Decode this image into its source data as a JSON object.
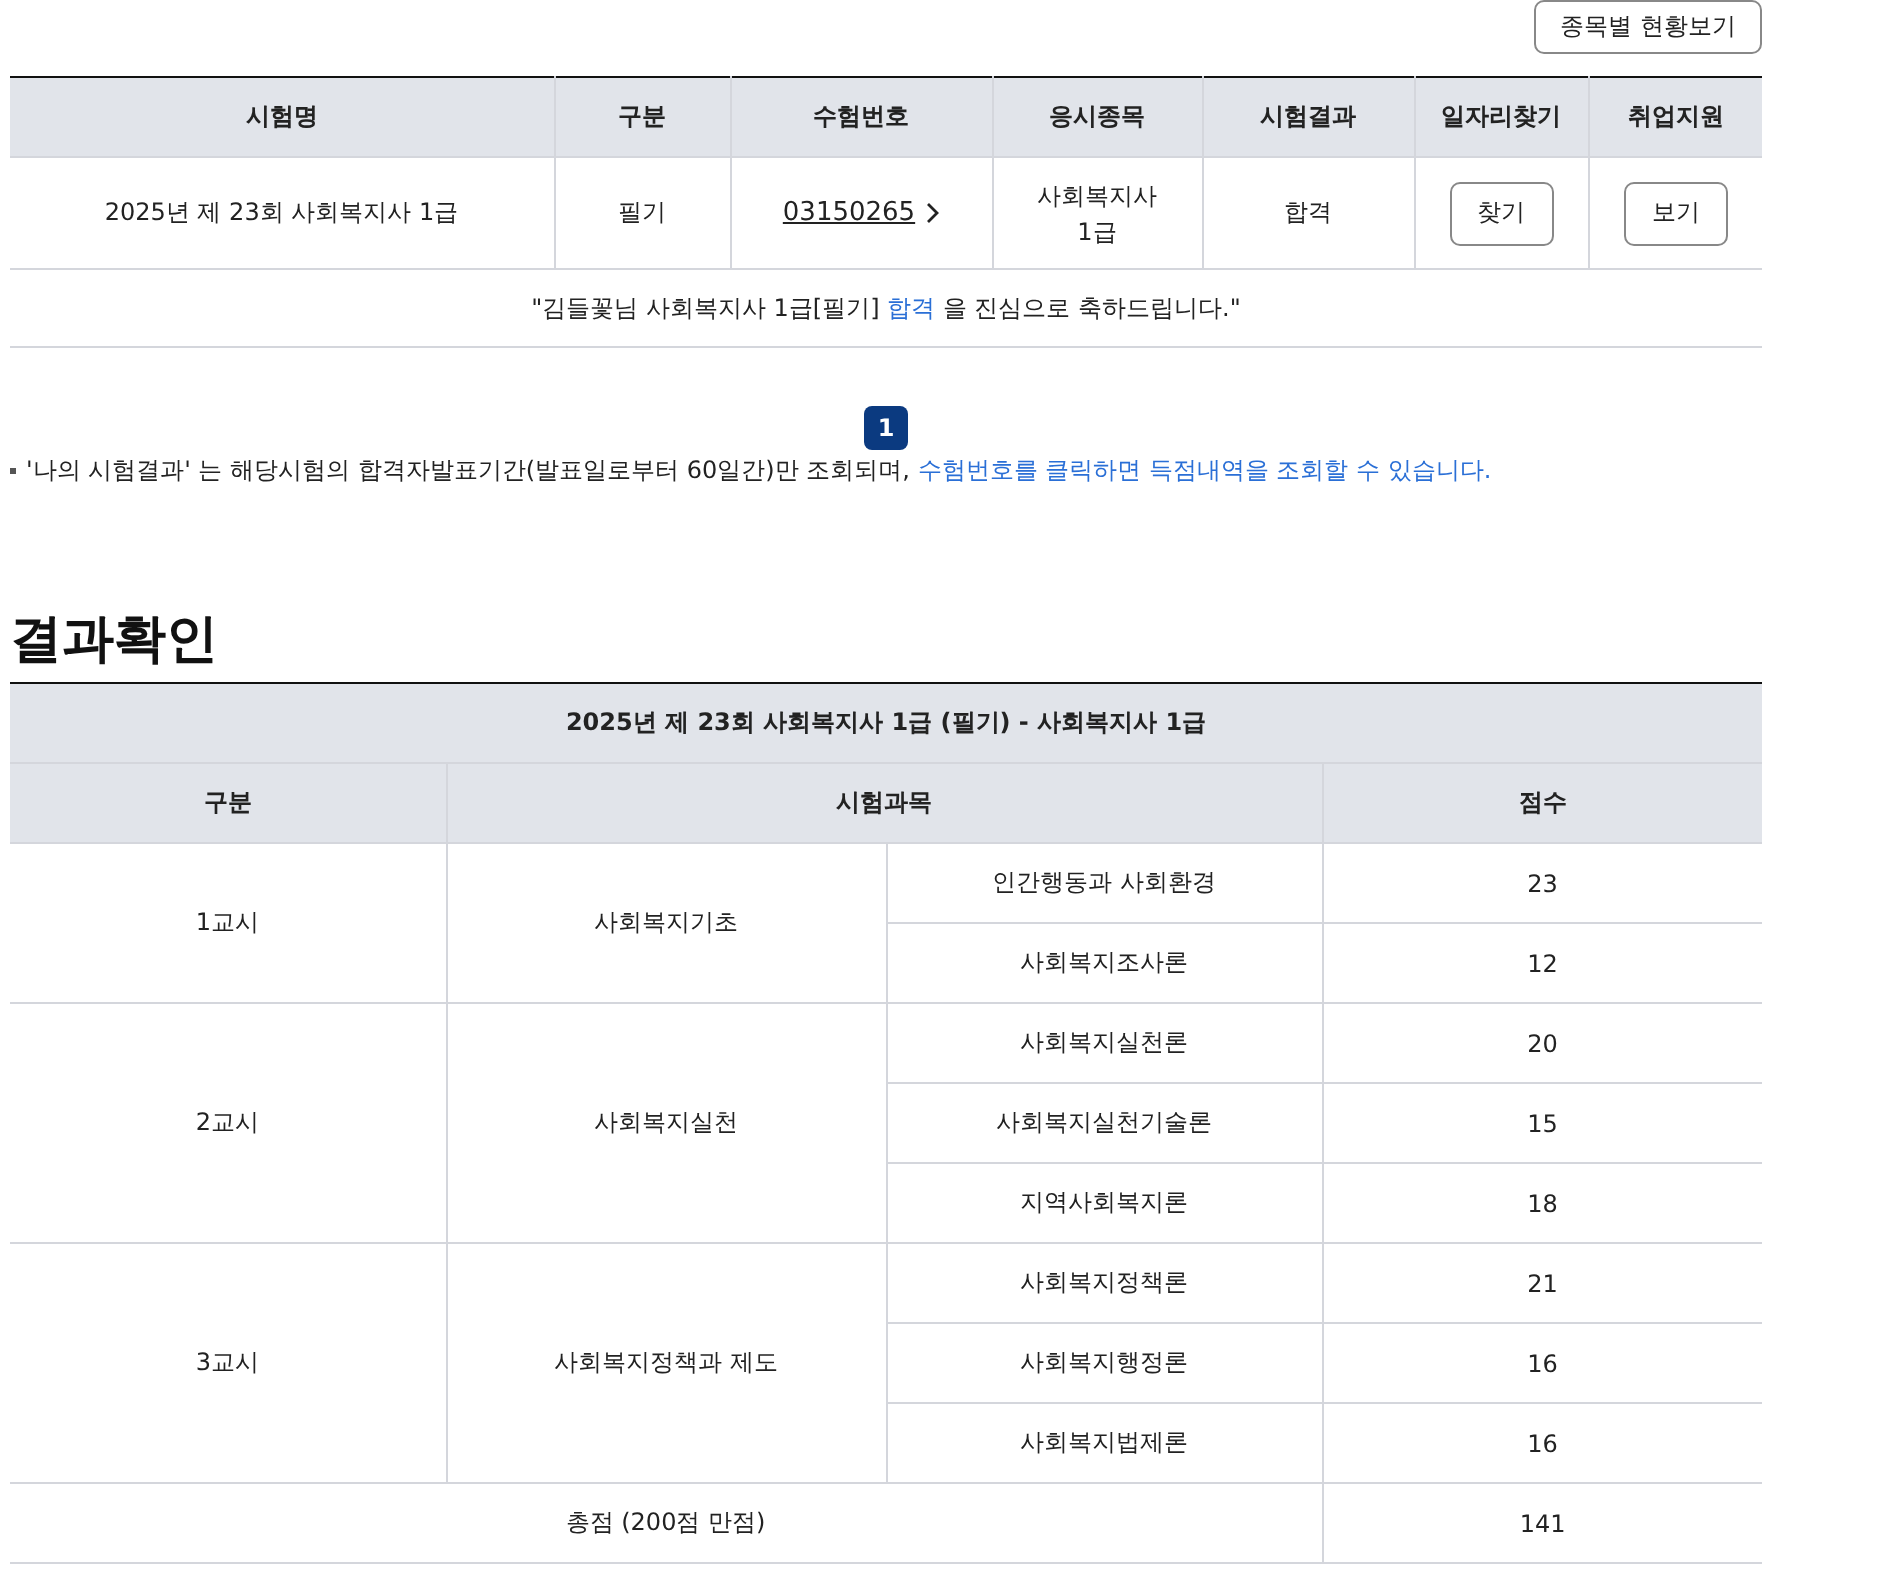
{
  "top_button": "종목별 현황보기",
  "exam_table": {
    "columns": [
      "시험명",
      "구분",
      "수험번호",
      "응시종목",
      "시험결과",
      "일자리찾기",
      "취업지원"
    ],
    "rows": [
      {
        "exam_name": "2025년 제 23회 사회복지사 1급",
        "type": "필기",
        "exam_number": "03150265",
        "category": "사회복지사 1급",
        "result": "합격",
        "job_button": "찾기",
        "support_button": "보기"
      }
    ]
  },
  "congrats": {
    "before": "\"김들꽃님 사회복지사 1급[필기] ",
    "highlight": "합격",
    "after": " 을 진심으로 축하드립니다.\""
  },
  "pagination": [
    {
      "label": "1",
      "selected": true
    }
  ],
  "notice": {
    "text": "'나의 시험결과' 는 해당시험의 합격자발표기간(발표일로부터 60일간)만 조회되며, ",
    "link": "수험번호를 클릭하면 득점내역을 조회할 수 있습니다."
  },
  "result": {
    "title": "결과확인",
    "caption": "2025년 제 23회 사회복지사 1급 (필기) - 사회복지사 1급",
    "columns": [
      "구분",
      "시험과목",
      "점수"
    ],
    "groups": [
      {
        "period": "1교시",
        "area": "사회복지기초",
        "subjects": [
          {
            "name": "인간행동과 사회환경",
            "score": "23"
          },
          {
            "name": "사회복지조사론",
            "score": "12"
          }
        ]
      },
      {
        "period": "2교시",
        "area": "사회복지실천",
        "subjects": [
          {
            "name": "사회복지실천론",
            "score": "20"
          },
          {
            "name": "사회복지실천기술론",
            "score": "15"
          },
          {
            "name": "지역사회복지론",
            "score": "18"
          }
        ]
      },
      {
        "period": "3교시",
        "area": "사회복지정책과 제도",
        "subjects": [
          {
            "name": "사회복지정책론",
            "score": "21"
          },
          {
            "name": "사회복지행정론",
            "score": "16"
          },
          {
            "name": "사회복지법제론",
            "score": "16"
          }
        ]
      }
    ],
    "total": {
      "label": "총점 (200점 만점)",
      "score": "141"
    }
  }
}
